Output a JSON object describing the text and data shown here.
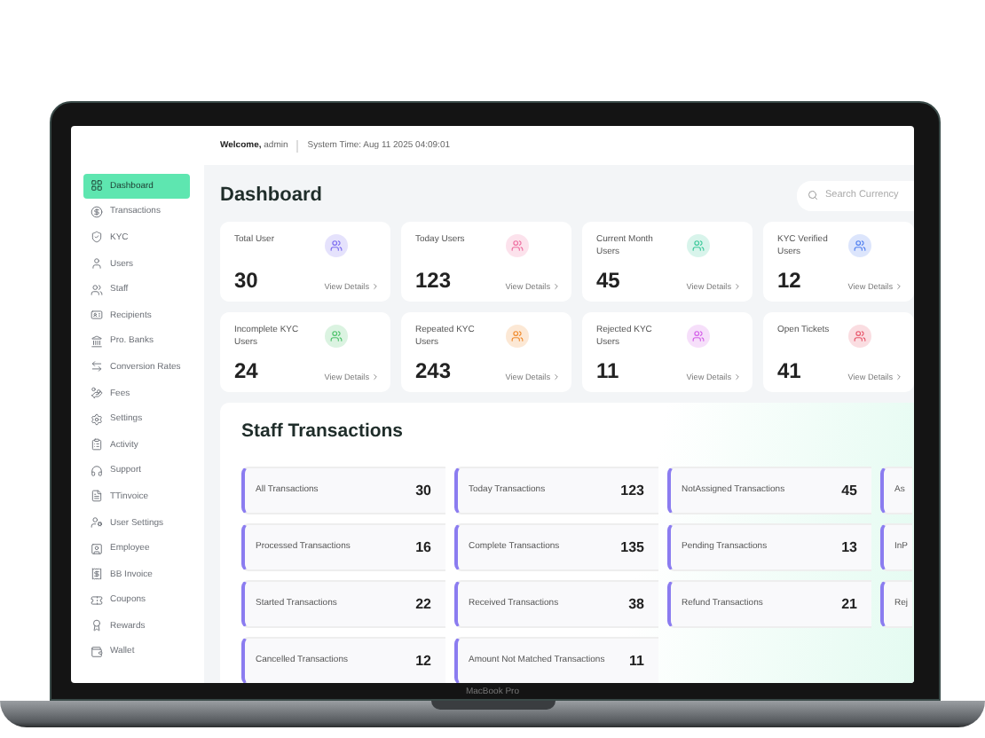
{
  "device_label": "MacBook Pro",
  "topbar": {
    "welcome_label": "Welcome,",
    "user": "admin",
    "system_time": "System Time: Aug 11 2025 04:09:01"
  },
  "sidebar": {
    "items": [
      {
        "kind": "grid",
        "label": "Dashboard",
        "selected": true
      },
      {
        "kind": "dollar",
        "label": "Transactions",
        "selected": false
      },
      {
        "kind": "shield",
        "label": "KYC",
        "selected": false
      },
      {
        "kind": "user",
        "label": "Users",
        "selected": false
      },
      {
        "kind": "users",
        "label": "Staff",
        "selected": false
      },
      {
        "kind": "card",
        "label": "Recipients",
        "selected": false
      },
      {
        "kind": "bank",
        "label": "Pro. Banks",
        "selected": false
      },
      {
        "kind": "exchange",
        "label": "Conversion Rates",
        "selected": false
      },
      {
        "kind": "coins",
        "label": "Fees",
        "selected": false
      },
      {
        "kind": "settings",
        "label": "Settings",
        "selected": false
      },
      {
        "kind": "clipboard",
        "label": "Activity",
        "selected": false
      },
      {
        "kind": "headset",
        "label": "Support",
        "selected": false
      },
      {
        "kind": "file",
        "label": "TTinvoice",
        "selected": false
      },
      {
        "kind": "usercog",
        "label": "User Settings",
        "selected": false
      },
      {
        "kind": "employee",
        "label": "Employee",
        "selected": false
      },
      {
        "kind": "receipt",
        "label": "BB Invoice",
        "selected": false
      },
      {
        "kind": "ticket",
        "label": "Coupons",
        "selected": false
      },
      {
        "kind": "award",
        "label": "Rewards",
        "selected": false
      },
      {
        "kind": "wallet",
        "label": "Wallet",
        "selected": false
      }
    ]
  },
  "page_title": "Dashboard",
  "search": {
    "placeholder": "Search Currency"
  },
  "stats": [
    {
      "label": "Total User",
      "value": "30",
      "link": "View Details",
      "color": "#7c6cf0"
    },
    {
      "label": "Today Users",
      "value": "123",
      "link": "View Details",
      "color": "#ee6ea0"
    },
    {
      "label": "Current Month Users",
      "value": "45",
      "link": "View Details",
      "color": "#3cc99a"
    },
    {
      "label": "KYC Verified Users",
      "value": "12",
      "link": "View Details",
      "color": "#4f7ff0"
    },
    {
      "label": "Incomplete KYC Users",
      "value": "24",
      "link": "View Details",
      "color": "#4cc26a"
    },
    {
      "label": "Repeated KYC Users",
      "value": "243",
      "link": "View Details",
      "color": "#f08a2c"
    },
    {
      "label": "Rejected KYC Users",
      "value": "11",
      "link": "View Details",
      "color": "#d35ee8"
    },
    {
      "label": "Open Tickets",
      "value": "41",
      "link": "View Details",
      "color": "#e8556a"
    }
  ],
  "staff_transactions": {
    "title": "Staff Transactions",
    "cards": [
      {
        "label": "All Transactions",
        "value": "30"
      },
      {
        "label": "Today Transactions",
        "value": "123"
      },
      {
        "label": "NotAssigned Transactions",
        "value": "45"
      },
      {
        "label": "As"
      },
      {
        "label": "Processed Transactions",
        "value": "16"
      },
      {
        "label": "Complete Transactions",
        "value": "135"
      },
      {
        "label": "Pending Transactions",
        "value": "13"
      },
      {
        "label": "InP"
      },
      {
        "label": "Started Transactions",
        "value": "22"
      },
      {
        "label": "Received Transactions",
        "value": "38"
      },
      {
        "label": "Refund Transactions",
        "value": "21"
      },
      {
        "label": "Rej"
      },
      {
        "label": "Cancelled Transactions",
        "value": "12"
      },
      {
        "label": "Amount Not Matched Transactions",
        "value": "11"
      }
    ]
  }
}
